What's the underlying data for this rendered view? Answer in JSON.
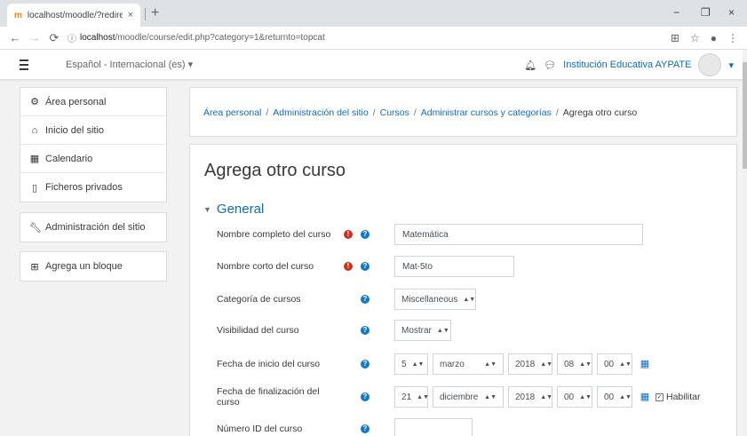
{
  "browser": {
    "tab_title": "localhost/moodle/?redirect=",
    "tab_close": "×",
    "new_tab": "+",
    "url_host": "localhost",
    "url_path": "/moodle/course/edit.php?category=1&returnto=topcat",
    "win_min": "−",
    "win_max": "❐",
    "win_close": "×"
  },
  "navbar": {
    "language": "Español - Internacional (es) ▾",
    "user_name": "Institución Educativa AYPATE",
    "user_menu_caret": "▾"
  },
  "nav_block": {
    "items": [
      {
        "label": "Área personal",
        "icon": "dashboard-icon"
      },
      {
        "label": "Inicio del sitio",
        "icon": "home-icon"
      },
      {
        "label": "Calendario",
        "icon": "calendar-icon"
      },
      {
        "label": "Ficheros privados",
        "icon": "file-icon"
      }
    ]
  },
  "admin_block": {
    "label": "Administración del sitio",
    "icon": "wrench-icon"
  },
  "add_block": {
    "label": "Agrega un bloque",
    "icon": "plus-square-icon"
  },
  "breadcrumb": {
    "items": [
      "Área personal",
      "Administración del sitio",
      "Cursos",
      "Administrar cursos y categorías"
    ],
    "current": "Agrega otro curso",
    "separator": "/"
  },
  "page": {
    "title": "Agrega otro curso",
    "section": "General"
  },
  "form": {
    "fullname": {
      "label": "Nombre completo del curso",
      "value": "Matemática"
    },
    "shortname": {
      "label": "Nombre corto del curso",
      "value": "Mat-5to"
    },
    "category": {
      "label": "Categoría de cursos",
      "value": "Miscellaneous"
    },
    "visibility": {
      "label": "Visibilidad del curso",
      "value": "Mostrar"
    },
    "startdate": {
      "label": "Fecha de inicio del curso",
      "day": "5",
      "month": "marzo",
      "year": "2018",
      "hour": "08",
      "minute": "00"
    },
    "enddate": {
      "label": "Fecha de finalización del curso",
      "day": "21",
      "month": "diciembre",
      "year": "2018",
      "hour": "00",
      "minute": "00",
      "enable_label": "Habilitar",
      "enabled": true
    },
    "idnumber": {
      "label": "Número ID del curso",
      "value": ""
    }
  },
  "colors": {
    "link": "#0f6cbf",
    "required": "#ca3120",
    "help": "#1177d1"
  }
}
